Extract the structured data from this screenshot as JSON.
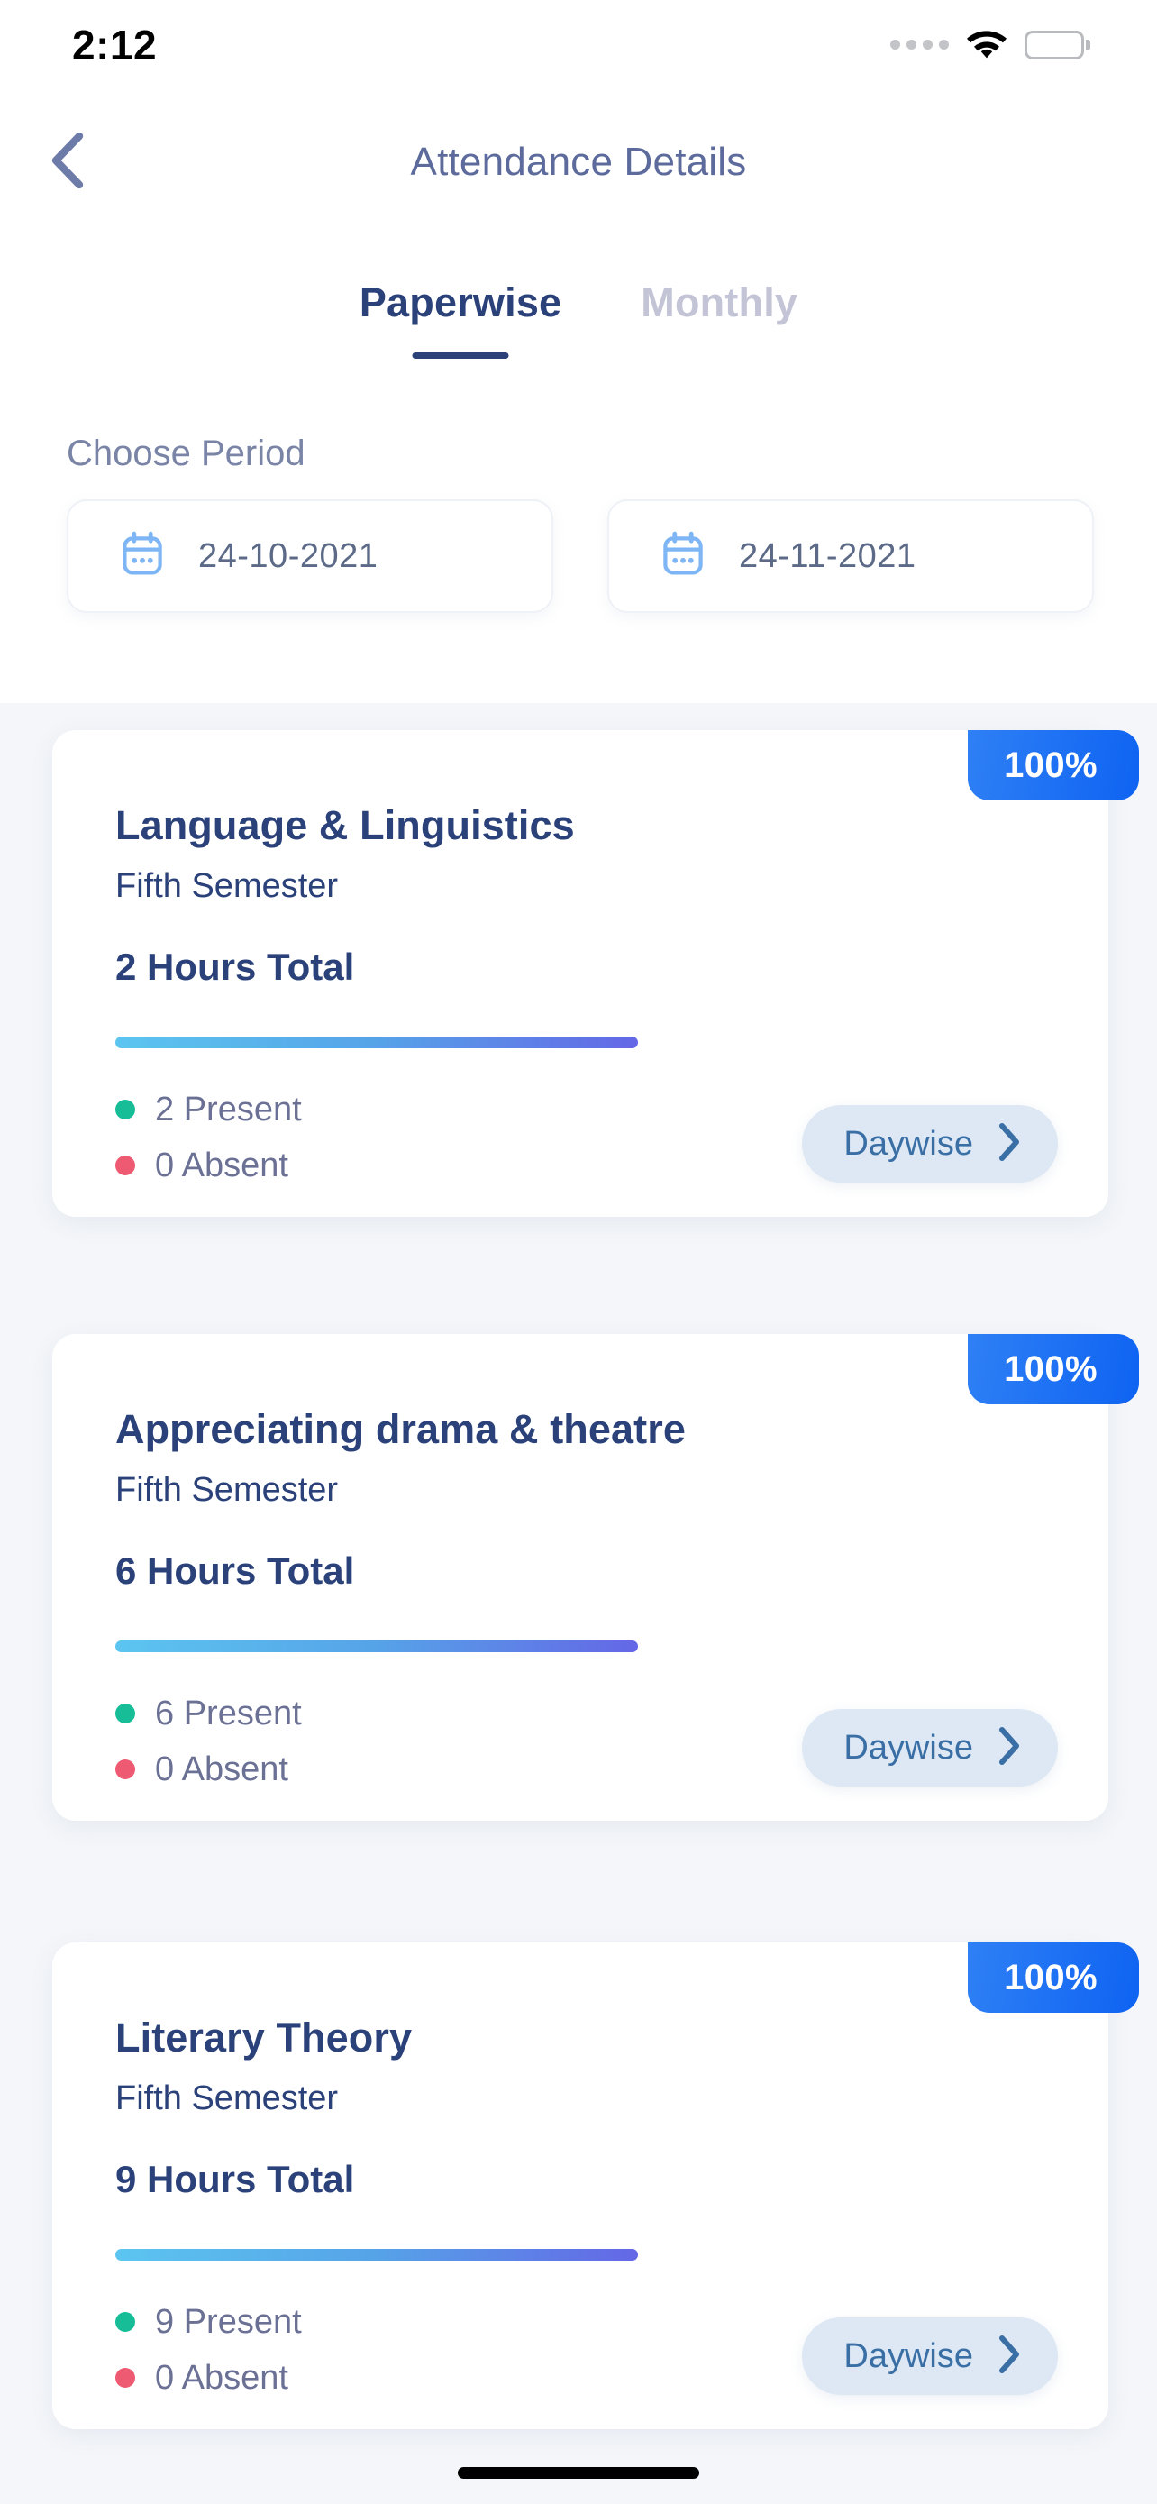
{
  "status_bar": {
    "time": "2:12",
    "signal_icon": "signal-dots-icon",
    "wifi_icon": "wifi-icon",
    "battery_icon": "battery-full-icon"
  },
  "header": {
    "back_icon": "chevron-left-icon",
    "title": "Attendance Details"
  },
  "tabs": [
    {
      "label": "Paperwise",
      "active": true
    },
    {
      "label": "Monthly",
      "active": false
    }
  ],
  "period": {
    "label": "Choose Period",
    "from": {
      "value": "24-10-2021",
      "icon": "calendar-icon"
    },
    "to": {
      "value": "24-11-2021",
      "icon": "calendar-icon"
    }
  },
  "colors": {
    "background": "#f4f6f9",
    "card": "#ffffff",
    "navy": "#2b4179",
    "title_muted": "#5c6a9c",
    "tab_inactive": "#c3c4d6",
    "badge_gradient_from": "#2f80f5",
    "badge_gradient_to": "#0e63f2",
    "bar_gradient_from": "#5cc5f0",
    "bar_gradient_to": "#6467e6",
    "present_dot": "#17bd97",
    "absent_dot": "#ee5a72",
    "legend_text": "#6b7095",
    "daywise_bg": "#dde8f4",
    "daywise_text": "#3a6fa5",
    "calendar_icon": "#7db5f5"
  },
  "courses": [
    {
      "title": "Language & Linguistics",
      "semester": "Fifth Semester",
      "hours": "2 Hours Total",
      "percent": "100%",
      "percent_value": 100,
      "present": "2 Present",
      "absent": "0 Absent",
      "present_count": 2,
      "absent_count": 0,
      "action": "Daywise",
      "action_icon": "chevron-right-icon"
    },
    {
      "title": "Appreciating drama & theatre",
      "semester": "Fifth Semester",
      "hours": "6 Hours Total",
      "percent": "100%",
      "percent_value": 100,
      "present": "6 Present",
      "absent": "0 Absent",
      "present_count": 6,
      "absent_count": 0,
      "action": "Daywise",
      "action_icon": "chevron-right-icon"
    },
    {
      "title": "Literary Theory",
      "semester": "Fifth Semester",
      "hours": "9 Hours Total",
      "percent": "100%",
      "percent_value": 100,
      "present": "9 Present",
      "absent": "0 Absent",
      "present_count": 9,
      "absent_count": 0,
      "action": "Daywise",
      "action_icon": "chevron-right-icon"
    }
  ]
}
